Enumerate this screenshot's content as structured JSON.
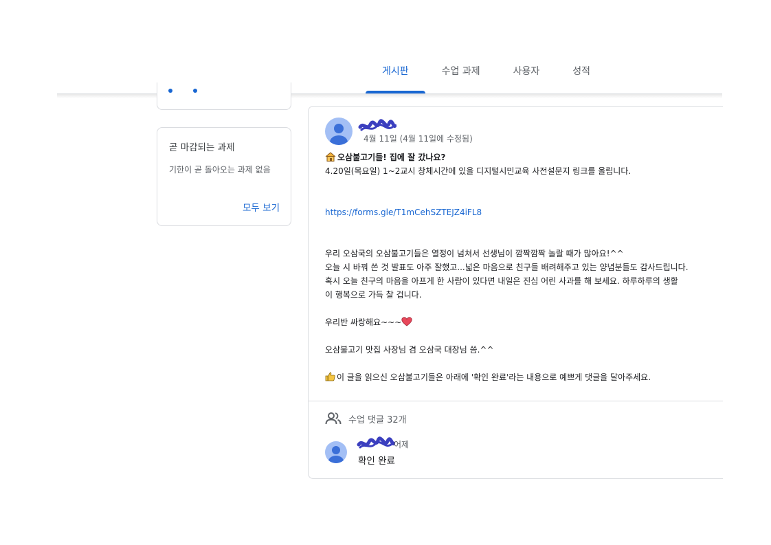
{
  "tabs": [
    {
      "label": "게시판"
    },
    {
      "label": "수업 과제"
    },
    {
      "label": "사용자"
    },
    {
      "label": "성적"
    }
  ],
  "due_card": {
    "title": "곧 마감되는 과제",
    "empty_text": "기한이 곧 돌아오는 과제 없음",
    "view_all": "모두 보기"
  },
  "post": {
    "date": "4월 11일 (4월 11일에 수정됨)",
    "title": "오삼불고기들! 집에 잘 갔나요?",
    "intro": "4.20일(목요일) 1~2교시 창체시간에 있을 디지털시민교육 사전설문지 링크를 올립니다.",
    "link": "https://forms.gle/T1mCehSZTEJZ4iFL8",
    "paragraph": [
      "우리 오삼국의 오삼불고기들은 열정이 넘쳐서 선생님이 깜짝깜짝 놀랄 때가 많아요!^^",
      "오늘 시 바꿔 쓴 것 발표도 아주 잘했고...넓은 마음으로 친구들 배려해주고 있는 양념분들도 감사드립니다.",
      "혹시 오늘 친구의 마음을 아프게 한 사람이 있다면 내일은 진심 어린 사과를 해 보세요. 하루하루의 생활",
      "이 행복으로 가득 찰 겁니다."
    ],
    "love": "우리반 싸랑해요~~~",
    "signature": "오삼불고기 맛집 사장님 겸 오삼국 대장님 씀.^^",
    "request": "이 글을 읽으신 오삼불고기들은 아래에 '확인 완료'라는 내용으로 예쁘게 댓글을 달아주세요.",
    "comment_count": "수업 댓글 32개"
  },
  "comment": {
    "time": "어제",
    "text": "확인 완료"
  },
  "colors": {
    "accent": "#1967d2",
    "avatar_bg": "#a3bff5",
    "avatar_fg": "#3a6fd8",
    "redaction": "#3b3fbf"
  }
}
